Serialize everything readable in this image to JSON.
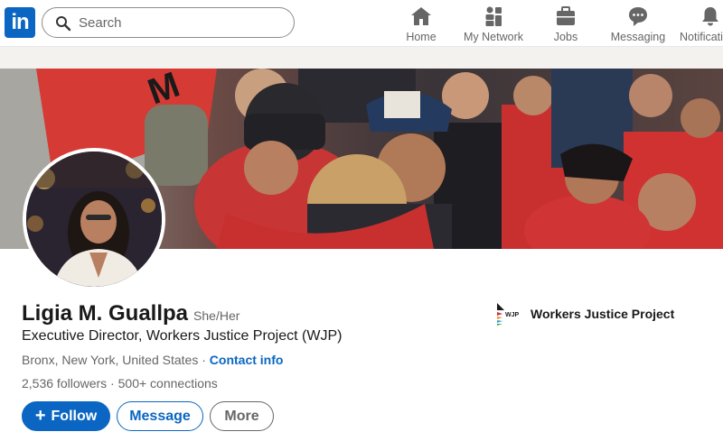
{
  "nav": {
    "logo_text": "in",
    "search_placeholder": "Search",
    "items": [
      {
        "label": "Home",
        "icon": "home-icon"
      },
      {
        "label": "My Network",
        "icon": "my-network-icon"
      },
      {
        "label": "Jobs",
        "icon": "jobs-icon"
      },
      {
        "label": "Messaging",
        "icon": "messaging-icon"
      },
      {
        "label": "Notifications",
        "icon": "notifications-icon"
      }
    ]
  },
  "profile": {
    "name": "Ligia M. Guallpa",
    "pronouns": "She/Her",
    "headline": "Executive Director, Workers Justice Project (WJP)",
    "location": "Bronx, New York, United States",
    "separator": "·",
    "contact_info": "Contact info",
    "followers": "2,536 followers",
    "connections": "500+ connections",
    "stats_separator": " · "
  },
  "actions": {
    "follow_plus": "+",
    "follow": "Follow",
    "message": "Message",
    "more": "More"
  },
  "organization": {
    "name": "Workers Justice Project",
    "logo_text": "WJP"
  },
  "colors": {
    "brand": "#0a66c2",
    "banner_red": "#d62f2f"
  }
}
